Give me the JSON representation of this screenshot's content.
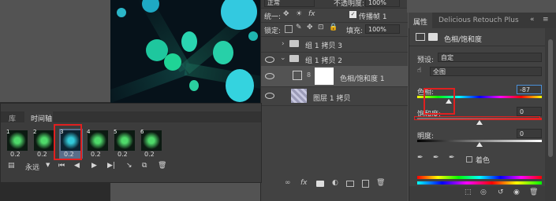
{
  "layers_panel": {
    "blend_mode": "正常",
    "opacity_label": "不透明度:",
    "opacity_value": "100%",
    "unify_label": "统一:",
    "propagate_label": "传播帧 1",
    "lock_label": "锁定:",
    "fill_label": "填充:",
    "fill_value": "100%",
    "layers": [
      {
        "name": "组 1 拷贝 3"
      },
      {
        "name": "组 1 拷贝 2"
      },
      {
        "name": "色相/饱和度 1"
      },
      {
        "name": "图层 1 拷贝"
      }
    ],
    "bottom_icons": [
      "link-icon",
      "fx-icon",
      "mask-icon",
      "adjustment-icon",
      "group-icon",
      "new-layer-icon",
      "trash-icon"
    ]
  },
  "properties_panel": {
    "tabs": [
      "属性",
      "Delicious Retouch Plus"
    ],
    "title": "色相/饱和度",
    "preset_label": "预设:",
    "preset_value": "自定",
    "channel_value": "全图",
    "hue_label": "色相:",
    "hue_value": "-87",
    "saturation_label": "饱和度:",
    "saturation_value": "0",
    "lightness_label": "明度:",
    "lightness_value": "0",
    "colorize_label": "着色",
    "hue_level": 0.25,
    "saturation_level": 0.5,
    "lightness_level": 0.5
  },
  "timeline": {
    "tabs": [
      "库",
      "时间轴"
    ],
    "active_tab": "时间轴",
    "frames": [
      {
        "num": "1",
        "delay": "0.2"
      },
      {
        "num": "2",
        "delay": "0.2"
      },
      {
        "num": "3",
        "delay": "0.2"
      },
      {
        "num": "4",
        "delay": "0.2"
      },
      {
        "num": "5",
        "delay": "0.2"
      },
      {
        "num": "6",
        "delay": "0.2"
      }
    ],
    "loop_value": "永远",
    "selected_frame": 3
  },
  "colors": {
    "panel_bg": "#424242",
    "highlight_red": "#e02020",
    "canvas_cyan": "#29c9d9",
    "canvas_green": "#24d98c"
  }
}
